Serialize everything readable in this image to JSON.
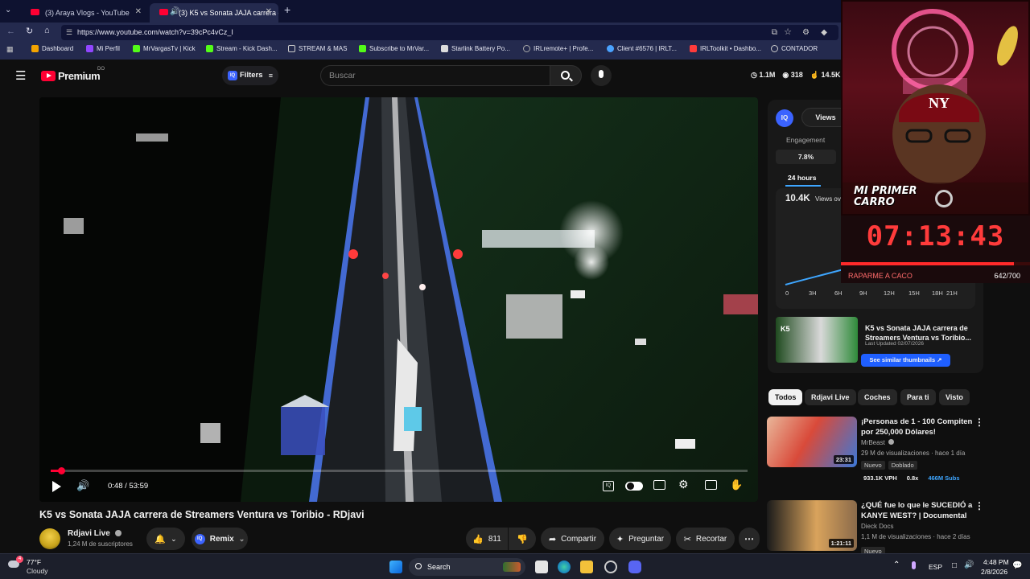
{
  "browser": {
    "tabs": [
      {
        "label": "(3) Araya Vlogs - YouTube",
        "active": false
      },
      {
        "label": "(3) K5 vs Sonata JAJA carrera d",
        "active": true
      }
    ],
    "new_tab": "+",
    "url": "https://www.youtube.com/watch?v=39cPc4vCz_I",
    "bookmarks": [
      {
        "label": "Dashboard",
        "color": "#f4a300"
      },
      {
        "label": "Mi Perfil",
        "color": "#9146ff"
      },
      {
        "label": "MrVargasTv | Kick",
        "color": "#53fc18"
      },
      {
        "label": "Stream - Kick Dash...",
        "color": "#53fc18"
      },
      {
        "label": "STREAM & MAS",
        "color": "#cccccc"
      },
      {
        "label": "Subscribe to MrVar...",
        "color": "#53fc18"
      },
      {
        "label": "Starlink Battery Po...",
        "color": "#dddddd"
      },
      {
        "label": "IRLremote+ | Profe...",
        "color": "#888888"
      },
      {
        "label": "Client #6576 | IRLT...",
        "color": "#4aa3ff"
      },
      {
        "label": "IRLToolkit • Dashbo...",
        "color": "#ff3b3b"
      },
      {
        "label": "CONTADOR",
        "color": "#cccccc"
      }
    ]
  },
  "yt": {
    "logo": "Premium",
    "logo_sup": "DO",
    "filters": "Filters",
    "search_placeholder": "Buscar",
    "stats": [
      {
        "icon": "clock-icon",
        "value": "1.1M"
      },
      {
        "icon": "eye-icon",
        "value": "318"
      },
      {
        "icon": "thumb-up-icon",
        "value": "14.5K"
      }
    ]
  },
  "player": {
    "time": "0:48 / 53:59",
    "progress": 0.015
  },
  "video": {
    "title": "K5 vs Sonata JAJA carrera de Streamers Ventura vs Toribio - RDjavi",
    "channel": "Rdjavi Live",
    "subscribers": "1,24 M de suscriptores",
    "remix": "Remix",
    "likes": "811",
    "share": "Compartir",
    "ask": "Preguntar",
    "clip": "Recortar"
  },
  "sidepanel": {
    "views_tab": "Views",
    "engagement_label": "Engagement",
    "engagement_value": "7.8%",
    "period": "24 hours",
    "views_value": "10.4K",
    "views_label": "Views ov",
    "x_axis": [
      "0",
      "3H",
      "6H",
      "9H",
      "12H",
      "15H",
      "18H",
      "21H"
    ],
    "thumb_title": "K5 vs Sonata JAJA carrera de Streamers Ventura vs Toribio...",
    "last_updated": "Last Updated 02/07/2026",
    "similar_btn": "See similar thumbnails ↗"
  },
  "chips": [
    {
      "label": "Todos",
      "active": true
    },
    {
      "label": "Rdjavi Live",
      "active": false
    },
    {
      "label": "Coches",
      "active": false
    },
    {
      "label": "Para ti",
      "active": false
    },
    {
      "label": "Visto",
      "active": false
    }
  ],
  "recommendations": [
    {
      "title": "¡Personas de 1 - 100 Compiten por 250,000 Dólares!",
      "channel": "MrBeast",
      "meta": "29 M de visualizaciones · hace 1 día",
      "badges": [
        "Nuevo",
        "Doblado"
      ],
      "stats": [
        "933.1K VPH",
        "0.8x",
        "466M Subs"
      ],
      "duration": "23:31"
    },
    {
      "title": "¿QUÉ fue lo que le SUCEDIÓ a KANYE WEST? | Documental",
      "channel": "Dieck Docs",
      "meta": "1,1 M de visualizaciones · hace 2 días",
      "badges": [
        "Nuevo"
      ],
      "stats": [],
      "duration": "1:21:11"
    }
  ],
  "overlay": {
    "caption": "MI PRIMER CARRO",
    "timer": "07:13:43",
    "goal_label": "RAPARME A CACO",
    "goal_value": "642/700",
    "goal_progress": 0.917
  },
  "taskbar": {
    "temp": "77°F",
    "weather": "Cloudy",
    "weather_badge": "4",
    "search": "Search",
    "lang": "ESP",
    "time": "4:48 PM",
    "date": "2/8/2026"
  },
  "colors": {
    "accent_red": "#ff0033",
    "timer_red": "#ff3b3b",
    "link_blue": "#3ea6ff"
  }
}
